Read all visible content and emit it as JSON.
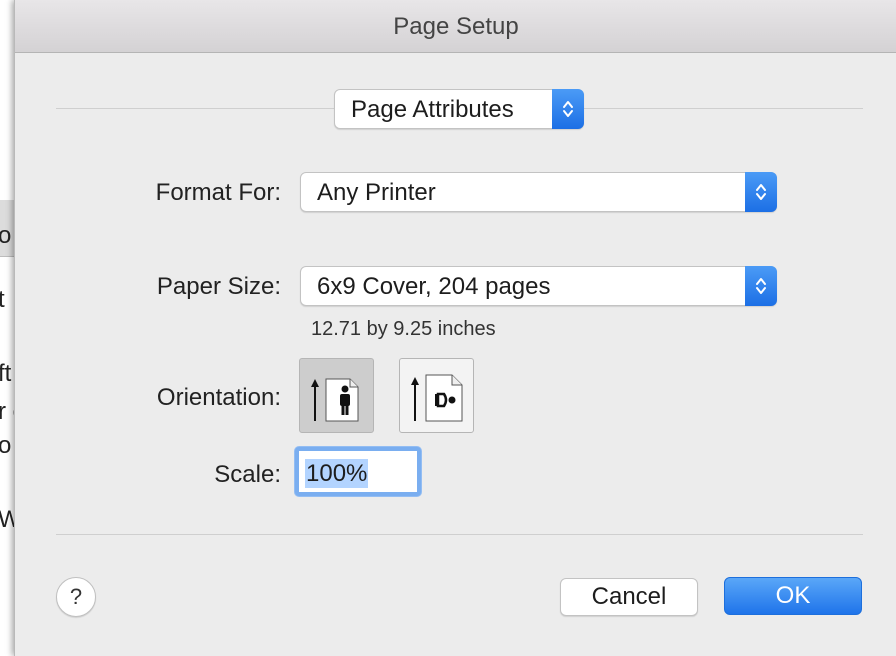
{
  "background": {
    "fragments": [
      "o",
      "t",
      "ft",
      "r c",
      "o",
      "W"
    ]
  },
  "dialog": {
    "title": "Page Setup",
    "settings_menu": {
      "value": "Page Attributes"
    },
    "format_for": {
      "label": "Format For:",
      "value": "Any Printer"
    },
    "paper_size": {
      "label": "Paper Size:",
      "value": "6x9 Cover, 204 pages",
      "dimensions": "12.71 by 9.25 inches"
    },
    "orientation": {
      "label": "Orientation:",
      "options": [
        {
          "name": "portrait",
          "icon": "portrait-orientation-icon",
          "selected": true
        },
        {
          "name": "landscape",
          "icon": "landscape-orientation-icon",
          "selected": false
        }
      ]
    },
    "scale": {
      "label": "Scale:",
      "value": "100%"
    },
    "help_label": "?",
    "cancel_label": "Cancel",
    "ok_label": "OK"
  },
  "colors": {
    "accent": "#1f74ea",
    "focus_ring": "#7aaef0",
    "dialog_bg": "#ececec"
  }
}
